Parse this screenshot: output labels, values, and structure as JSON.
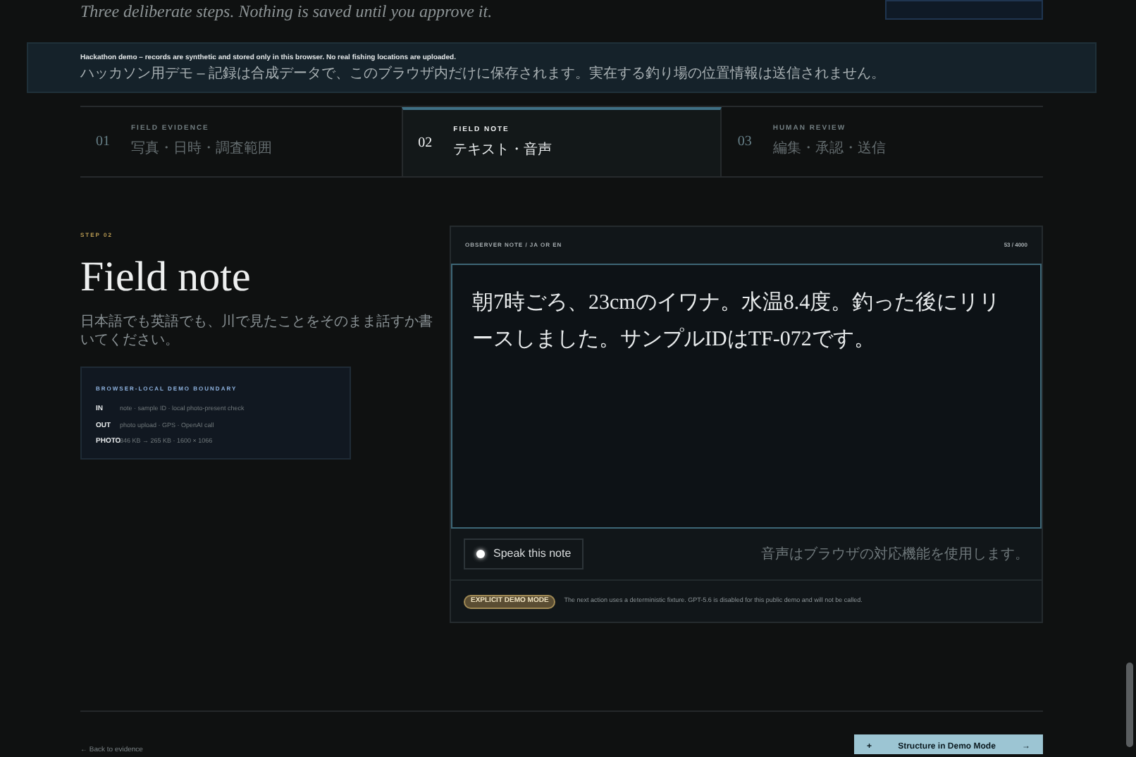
{
  "intro": {
    "subtitle": "Three deliberate steps. Nothing is saved until you approve it."
  },
  "banner": {
    "title": "Hackathon demo – records are synthetic and stored only in this browser. No real fishing locations are uploaded.",
    "subtitle": "ハッカソン用デモ – 記録は合成データで、このブラウザ内だけに保存されます。実在する釣り場の位置情報は送信されません。"
  },
  "steps": [
    {
      "number": "01",
      "title": "FIELD EVIDENCE",
      "subtitle": "写真・日時・調査範囲",
      "selected": false
    },
    {
      "number": "02",
      "title": "FIELD NOTE",
      "subtitle": "テキスト・音声",
      "selected": true
    },
    {
      "number": "03",
      "title": "HUMAN REVIEW",
      "subtitle": "編集・承認・送信",
      "selected": false
    }
  ],
  "section": {
    "eyebrow": "STEP 02",
    "title": "Field note",
    "description": "日本語でも英語でも、川で見たことをそのまま話すか書いてください。"
  },
  "boundary": {
    "title": "BROWSER-LOCAL DEMO BOUNDARY",
    "rows": [
      {
        "label": "IN",
        "value": "note · sample ID · local photo-present check"
      },
      {
        "label": "OUT",
        "value": "photo upload · GPS · OpenAI call"
      },
      {
        "label": "PHOTO",
        "value": "346 KB → 265 KB · 1600 × 1066"
      }
    ]
  },
  "note": {
    "label": "OBSERVER NOTE / JA OR EN",
    "counter": "53 / 4000",
    "value": "朝7時ごろ、23cmのイワナ。水温8.4度。釣った後にリリースしました。サンプルIDはTF-072です。",
    "speak_button": "Speak this note",
    "speak_hint": "音声はブラウザの対応機能を使用します。",
    "badge": "EXPLICIT DEMO MODE",
    "disclaimer": "The next action uses a deterministic fixture. GPT-5.6 is disabled for this public demo and will not be called."
  },
  "footer": {
    "back_link": "← Back to evidence",
    "primary_button": {
      "icon": "+",
      "label": "Structure in Demo Mode",
      "arrow": "→"
    }
  }
}
